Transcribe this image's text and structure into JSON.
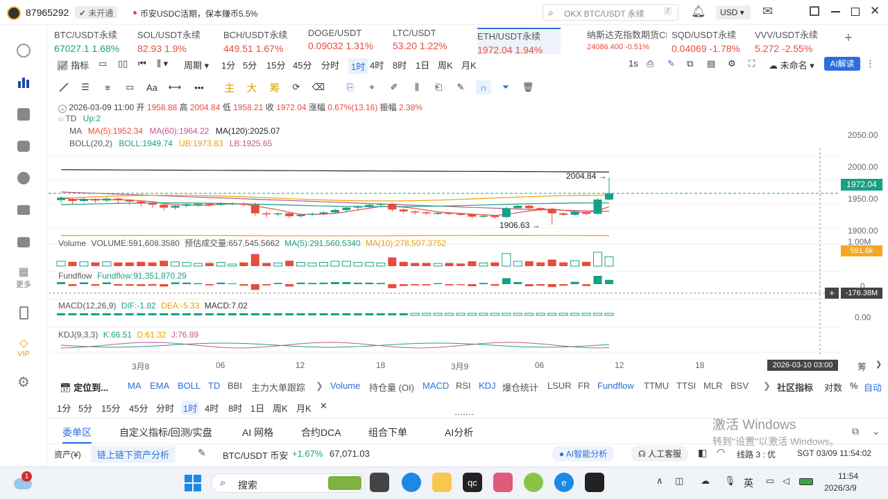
{
  "titlebar": {
    "account_id": "87965292",
    "account_status": "未开通",
    "notice": "币安USDC活期，保本赚币5.5%",
    "search_placeholder": "OKX BTC/USDT 永续",
    "search_shortcut": "/",
    "currency": "USD"
  },
  "leftnav": {
    "more_label": "更多",
    "vip_label": "VIP"
  },
  "tickers": [
    {
      "name": "BTC/USDT永续",
      "price": "67027.1",
      "change": "1.68%",
      "dir": "up"
    },
    {
      "name": "SOL/USDT永续",
      "price": "82.93",
      "change": "1.9%",
      "dir": "dn"
    },
    {
      "name": "BCH/USDT永续",
      "price": "449.51",
      "change": "1.67%",
      "dir": "dn"
    },
    {
      "name": "DOGE/USDT",
      "price": "0.09032",
      "change": "1.31%",
      "dir": "dn"
    },
    {
      "name": "LTC/USDT",
      "price": "53.20",
      "change": "1.22%",
      "dir": "dn"
    },
    {
      "name": "ETH/USDT永续",
      "price": "1972.04",
      "change": "1.94%",
      "dir": "dn"
    },
    {
      "name": "纳斯达克指数期货CFD",
      "price": "24086.400",
      "change": "-0.51%",
      "dir": "dn"
    },
    {
      "name": "SQD/USDT永续",
      "price": "0.04069",
      "change": "-1.78%",
      "dir": "dn"
    },
    {
      "name": "VVV/USDT永续",
      "price": "5.272",
      "change": "-2.55%",
      "dir": "dn"
    }
  ],
  "toolbar": {
    "indicator": "指标",
    "period": "周期",
    "intervals": [
      "1分",
      "5分",
      "15分",
      "45分",
      "分时",
      "1时",
      "4时",
      "8时",
      "1日",
      "周K",
      "月K"
    ],
    "active_interval": "1时",
    "speed": "1s",
    "unnamed": "未命名",
    "ai_btn": "AI解读"
  },
  "drawtools": {
    "main": "主",
    "big": "大",
    "chip": "筹"
  },
  "ohlc": {
    "date": "2026-03-09 11:00",
    "open_l": "开",
    "open": "1958.88",
    "high_l": "高",
    "high": "2004.84",
    "low_l": "低",
    "low": "1958.21",
    "close_l": "收",
    "close": "1972.04",
    "chg_l": "涨幅",
    "chg": "0.67%(13.16)",
    "amp_l": "振幅",
    "amp": "2.38%"
  },
  "legends": {
    "td": "TD",
    "td_up": "Up:2",
    "ma": "MA",
    "ma5": "MA(5):1952.34",
    "ma60": "MA(60):1964.22",
    "ma120": "MA(120):2025.07",
    "boll": "BOLL(20,2)",
    "boll_v": "BOLL:1949.74",
    "boll_ub": "UB:1973.83",
    "boll_lb": "LB:1925.65",
    "vol": "Volume",
    "vol_v": "VOLUME:591,608.3580",
    "vol_est": "预估成交量:657,545.5662",
    "vol_ma5": "MA(5):291,560.5340",
    "vol_ma10": "MA(10):278,507.3752",
    "ff": "Fundflow",
    "ff_v": "Fundflow:91,351,870.29",
    "macd": "MACD(12,26,9)",
    "dif": "DIF:-1.82",
    "dea": "DEA:-5.33",
    "macd_v": "MACD:7.02",
    "kdj": "KDJ(9,3,3)",
    "k": "K:66.51",
    "d": "D:61.32",
    "j": "J:76.89"
  },
  "chart_data": {
    "type": "candlestick",
    "symbol": "ETH/USDT永续",
    "interval": "1时",
    "y_ticks": [
      "2050.00",
      "2000.00",
      "1950.00",
      "1900.00"
    ],
    "last_price": "1972.04",
    "max_label": "2004.84",
    "min_label": "1906.63",
    "vol_ticks": [
      "1.00M"
    ],
    "vol_last": "591.6k",
    "ff_tick": "0",
    "ff_cursor": "-176.38M",
    "macd_tick": "0.00",
    "x_ticks": [
      "3月8",
      "06",
      "12",
      "18",
      "3月9",
      "06",
      "12",
      "18"
    ],
    "crosshair_time": "2026-03-10 03:00",
    "candles": [
      [
        1958,
        1963,
        1952,
        1966
      ],
      [
        1960,
        1956,
        1950,
        1962
      ],
      [
        1956,
        1960,
        1953,
        1963
      ],
      [
        1960,
        1957,
        1952,
        1962
      ],
      [
        1957,
        1961,
        1954,
        1964
      ],
      [
        1961,
        1958,
        1950,
        1963
      ],
      [
        1958,
        1955,
        1948,
        1960
      ],
      [
        1955,
        1951,
        1944,
        1957
      ],
      [
        1951,
        1948,
        1942,
        1953
      ],
      [
        1948,
        1942,
        1936,
        1950
      ],
      [
        1942,
        1946,
        1938,
        1948
      ],
      [
        1946,
        1949,
        1942,
        1951
      ],
      [
        1949,
        1950,
        1944,
        1952
      ],
      [
        1950,
        1948,
        1944,
        1953
      ],
      [
        1948,
        1951,
        1946,
        1954
      ],
      [
        1951,
        1951,
        1947,
        1953
      ],
      [
        1951,
        1948,
        1944,
        1953
      ],
      [
        1948,
        1930,
        1925,
        1952
      ],
      [
        1930,
        1928,
        1922,
        1934
      ],
      [
        1928,
        1930,
        1924,
        1932
      ],
      [
        1930,
        1924,
        1920,
        1933
      ],
      [
        1924,
        1927,
        1921,
        1930
      ],
      [
        1927,
        1929,
        1924,
        1932
      ],
      [
        1929,
        1932,
        1926,
        1935
      ],
      [
        1932,
        1937,
        1929,
        1940
      ],
      [
        1937,
        1942,
        1933,
        1945
      ],
      [
        1942,
        1945,
        1938,
        1947
      ],
      [
        1945,
        1948,
        1941,
        1950
      ],
      [
        1948,
        1950,
        1944,
        1952
      ],
      [
        1950,
        1938,
        1933,
        1952
      ],
      [
        1938,
        1934,
        1930,
        1940
      ],
      [
        1934,
        1932,
        1928,
        1936
      ],
      [
        1932,
        1930,
        1927,
        1934
      ],
      [
        1930,
        1931,
        1927,
        1933
      ],
      [
        1931,
        1929,
        1926,
        1933
      ],
      [
        1929,
        1928,
        1924,
        1931
      ],
      [
        1928,
        1923,
        1920,
        1930
      ],
      [
        1923,
        1925,
        1920,
        1927
      ],
      [
        1925,
        1922,
        1918,
        1927
      ],
      [
        1922,
        1941,
        1920,
        1944
      ],
      [
        1941,
        1946,
        1938,
        1948
      ],
      [
        1946,
        1941,
        1936,
        1948
      ],
      [
        1941,
        1938,
        1934,
        1943
      ],
      [
        1938,
        1930,
        1906,
        1941
      ],
      [
        1930,
        1927,
        1924,
        1932
      ],
      [
        1927,
        1933,
        1925,
        1935
      ],
      [
        1933,
        1929,
        1926,
        1936
      ],
      [
        1929,
        1959,
        1927,
        1962
      ],
      [
        1959,
        1972,
        1958,
        2005
      ]
    ]
  },
  "bottom": {
    "locate": "定位到...",
    "indicators": [
      "MA",
      "EMA",
      "BOLL",
      "TD",
      "BBI",
      "主力大单跟踪"
    ],
    "sub_indicators": [
      "Volume",
      "持仓量 (OI)",
      "MACD",
      "RSI",
      "KDJ",
      "爆仓统计",
      "LSUR",
      "FR",
      "Fundflow",
      "TTMU",
      "TTSI",
      "MLR",
      "BSV"
    ],
    "community": "社区指标",
    "log": "对数",
    "pct": "%",
    "auto": "自动",
    "intervals": [
      "1分",
      "5分",
      "15分",
      "45分",
      "分时",
      "1时",
      "4时",
      "8时",
      "1日",
      "周K",
      "月K"
    ],
    "close_icon": "✕",
    "filter": "筹",
    "tabs": [
      "委单区",
      "自定义指标/回测/实盘",
      "AI 网格",
      "合约DCA",
      "组合下单",
      "AI分析"
    ],
    "status": {
      "assets": "资产(¥)",
      "chain": "链上链下资产分析",
      "pair": "BTC/USDT 币安",
      "pair_chg": "+1.67%",
      "pair_price": "67,071.03",
      "ai_analysis": "AI智能分析",
      "service": "人工客服",
      "route": "线路 3 : 优",
      "time": "SGT 03/09 11:54:02"
    },
    "watermark1": "激活 Windows",
    "watermark2": "转到\"设置\"以激活 Windows。"
  },
  "taskbar": {
    "search": "搜索",
    "badge": "1",
    "ime": "英",
    "clock_time": "11:54",
    "clock_date": "2026/3/9"
  }
}
